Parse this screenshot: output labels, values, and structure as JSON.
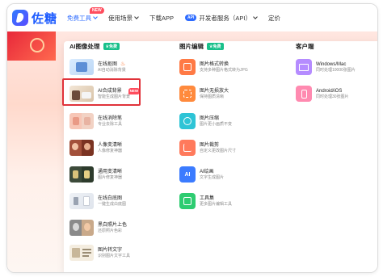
{
  "nav": {
    "logo_text": "佐糖",
    "items": [
      {
        "label": "免费工具",
        "active": true,
        "badge": "NEW"
      },
      {
        "label": "使用场景"
      },
      {
        "label": "下载APP"
      },
      {
        "label": "开发者服务（API）",
        "badge": "API"
      },
      {
        "label": "定价"
      }
    ]
  },
  "menu": {
    "free_tag": "免费",
    "columns": [
      {
        "heading": "AI图像处理",
        "items": [
          {
            "title": "在线抠图",
            "desc": "AI自动消除背景",
            "icon": "cutout-icon",
            "flame": true
          },
          {
            "title": "AI合成背景",
            "desc": "智能生成图片背景",
            "icon": "ai-background-icon",
            "badge": "NEW"
          },
          {
            "title": "在线消除笔",
            "desc": "专业去除工具",
            "icon": "eraser-icon"
          },
          {
            "title": "人像变清晰",
            "desc": "人像修复神器",
            "icon": "portrait-enhance-icon"
          },
          {
            "title": "通用变清晰",
            "desc": "图片修复神器",
            "icon": "general-enhance-icon"
          },
          {
            "title": "在线白底图",
            "desc": "一键生成白底图",
            "icon": "white-background-icon"
          },
          {
            "title": "黑白照片上色",
            "desc": "还原照片色彩",
            "icon": "colorize-icon"
          },
          {
            "title": "图片转文字",
            "desc": "识别图片文字工具",
            "icon": "ocr-icon"
          }
        ]
      },
      {
        "heading": "图片编辑",
        "items": [
          {
            "title": "图片格式转换",
            "desc": "支持多种图片格式转为JPG",
            "icon": "format-convert-icon",
            "color": "#ff7a45"
          },
          {
            "title": "图片无损放大",
            "desc": "保持图质清晰",
            "icon": "upscale-icon",
            "color": "#ff8a3d"
          },
          {
            "title": "图片压缩",
            "desc": "图片更小画质不变",
            "icon": "compress-icon",
            "color": "#2ec4d6"
          },
          {
            "title": "图片裁剪",
            "desc": "自定义更改图片尺寸",
            "icon": "crop-icon",
            "color": "#ff7a5c"
          },
          {
            "title": "AI绘画",
            "desc": "文字生成图片",
            "icon": "ai-paint-icon",
            "color": "#3b7bff"
          },
          {
            "title": "工具集",
            "desc": "更多图片编辑工具",
            "icon": "toolkit-icon",
            "color": "#2ecc71"
          }
        ]
      },
      {
        "heading": "客户端",
        "items": [
          {
            "title": "Windows/Mac",
            "desc": "同时处理10000张图片",
            "icon": "desktop-icon",
            "color": "#b58cff"
          },
          {
            "title": "Android/iOS",
            "desc": "同时处理30张图片",
            "icon": "mobile-icon",
            "color": "#ff8ab0"
          }
        ]
      }
    ]
  },
  "colors": {
    "brand": "#1e5cff",
    "highlight_border": "#e0323a",
    "free_tag": "#18c08a",
    "new_badge": "#ff4d5e"
  }
}
